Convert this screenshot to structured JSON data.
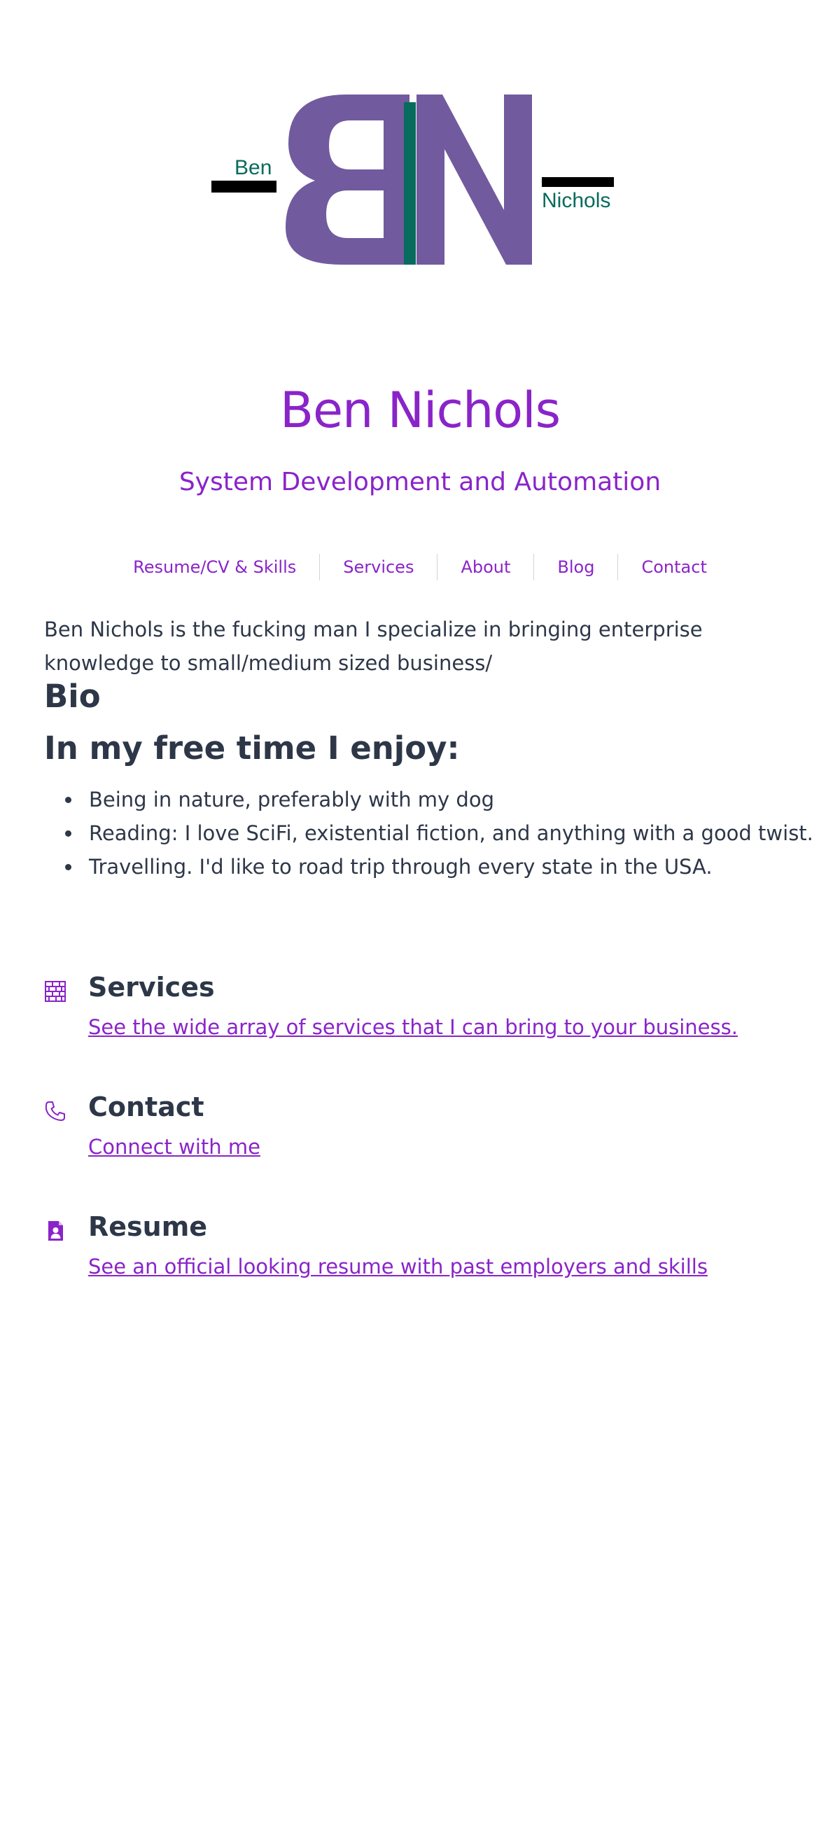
{
  "logo": {
    "first_name": "Ben",
    "last_name": "Nichols",
    "purple": "#715a9e",
    "teal": "#076b5d"
  },
  "header": {
    "title": "Ben Nichols",
    "tagline": "System Development and Automation"
  },
  "nav": [
    {
      "label": "Resume/CV & Skills"
    },
    {
      "label": "Services"
    },
    {
      "label": "About"
    },
    {
      "label": "Blog"
    },
    {
      "label": "Contact"
    }
  ],
  "intro": "Ben Nichols is the fucking man I specialize in bringing enterprise knowledge to small/medium sized business/",
  "bio_heading": "Bio",
  "free_time": {
    "heading": "In my free time I enjoy:",
    "items": [
      "Being in nature, preferably with my dog",
      "Reading: I love SciFi, existential fiction, and anything with a good twist.",
      "Travelling. I'd like to road trip through every state in the USA."
    ]
  },
  "cards": [
    {
      "icon": "brick-wall-icon",
      "title": "Services",
      "description": "See the wide array of services that I can bring to your business."
    },
    {
      "icon": "phone-icon",
      "title": "Contact",
      "description": "Connect with me"
    },
    {
      "icon": "resume-document-icon",
      "title": "Resume",
      "description": "See an official looking resume with past employers and skills"
    }
  ],
  "colors": {
    "accent": "#8a24c9",
    "text": "#2d3748"
  }
}
